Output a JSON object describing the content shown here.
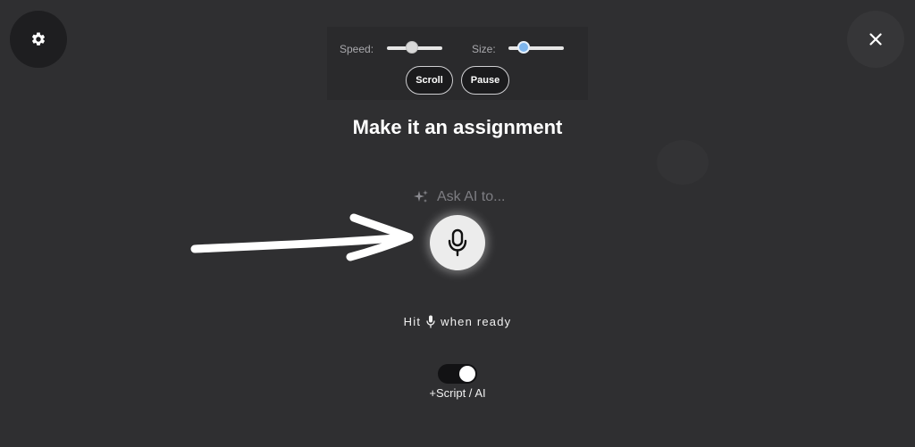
{
  "icons": {
    "settings": "gear-icon",
    "close": "close-icon",
    "ask_ai": "sparkles-icon",
    "mic": "microphone-icon",
    "arrow": "arrow-right-icon"
  },
  "controls": {
    "speed_label": "Speed:",
    "speed_value": 0.45,
    "size_label": "Size:",
    "size_value": 0.28,
    "scroll_label": "Scroll",
    "pause_label": "Pause"
  },
  "heading": "Make it an assignment",
  "ask_ai": {
    "placeholder": "Ask AI to..."
  },
  "hint": {
    "before": "Hit",
    "after": "when ready"
  },
  "toggle": {
    "on": true,
    "label": "+Script / AI"
  },
  "colors": {
    "background": "#2f2f31",
    "size_thumb": "#7eb6ee",
    "mic_button": "#ececec"
  }
}
